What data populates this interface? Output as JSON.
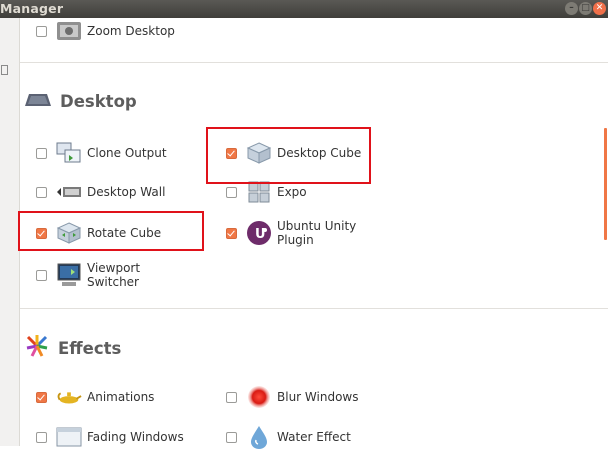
{
  "window": {
    "title": "Manager",
    "minimize": "–",
    "maximize": "□",
    "close": "✕"
  },
  "sections": {
    "desktop": {
      "heading": "Desktop"
    },
    "effects": {
      "heading": "Effects"
    }
  },
  "plugins": {
    "zoom_desktop": {
      "label": "Zoom Desktop",
      "checked": false
    },
    "clone_output": {
      "label": "Clone Output",
      "checked": false
    },
    "desktop_cube": {
      "label": "Desktop Cube",
      "checked": true
    },
    "desktop_wall": {
      "label": "Desktop Wall",
      "checked": false
    },
    "expo": {
      "label": "Expo",
      "checked": false
    },
    "rotate_cube": {
      "label": "Rotate Cube",
      "checked": true
    },
    "ubuntu_unity_1": "Ubuntu Unity",
    "ubuntu_unity_2": "Plugin",
    "ubuntu_unity_checked": true,
    "viewport_1": "Viewport",
    "viewport_2": "Switcher",
    "viewport_checked": false,
    "animations": {
      "label": "Animations",
      "checked": true
    },
    "blur_windows": {
      "label": "Blur Windows",
      "checked": false
    },
    "fading_windows": {
      "label": "Fading Windows",
      "checked": false
    },
    "water_effect": {
      "label": "Water Effect",
      "checked": false
    }
  },
  "colors": {
    "accent": "#f07746",
    "highlight_box": "#e0121a"
  }
}
